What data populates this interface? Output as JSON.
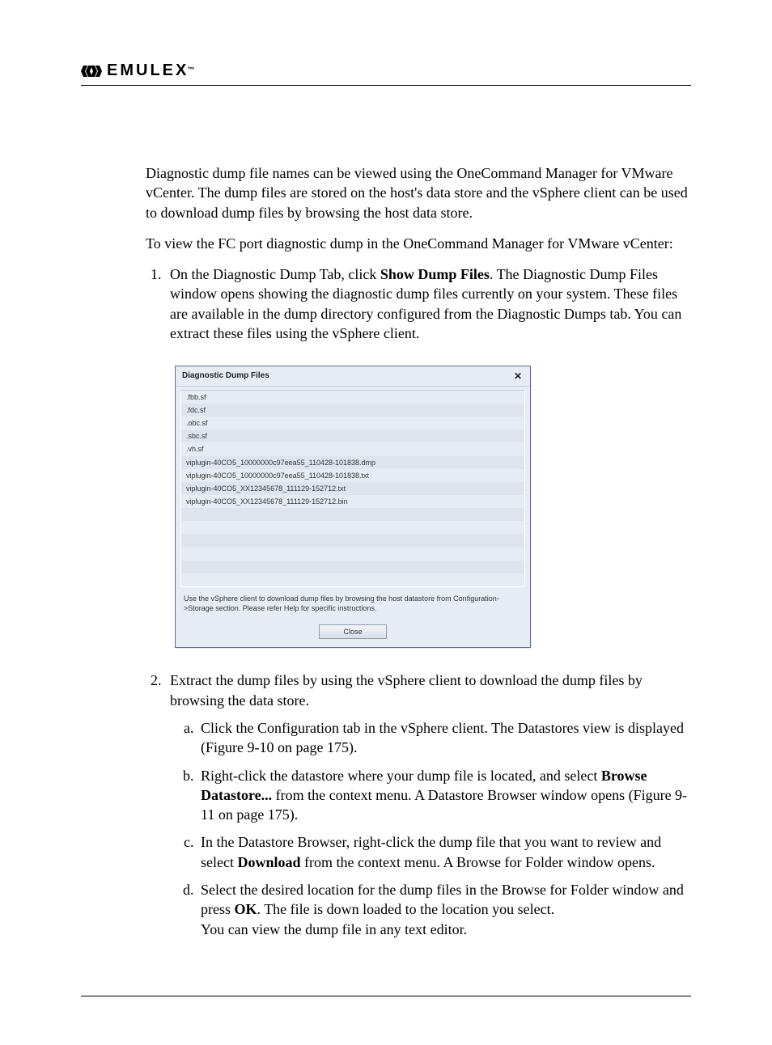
{
  "brand": {
    "name": "EMULEX",
    "trademark": "™"
  },
  "paragraphs": {
    "p1": "Diagnostic dump file names can be viewed using the OneCommand Manager for VMware vCenter. The dump files are stored on the host's data store and the vSphere client can be used to download dump files by browsing the host data store.",
    "p2": "To view the FC port diagnostic dump in the OneCommand Manager for VMware vCenter:"
  },
  "steps": {
    "s1_pre": "On the Diagnostic Dump Tab, click ",
    "s1_bold": "Show Dump Files",
    "s1_post": ". The Diagnostic Dump Files window opens showing the diagnostic dump files currently on your system. These files are available in the dump directory configured from the Diagnostic Dumps tab. You can extract these files using the vSphere client.",
    "s2": "Extract the dump files by using the vSphere client to download the dump files by browsing the data store.",
    "s2a": "Click the Configuration tab in the vSphere client. The Datastores view is displayed (Figure 9-10 on page 175).",
    "s2b_pre": "Right-click the datastore where your dump file is located, and select ",
    "s2b_bold": "Browse Datastore...",
    "s2b_post": " from the context menu. A Datastore Browser window opens (Figure 9-11 on page 175).",
    "s2c_pre": "In the Datastore Browser, right-click the dump file that you want to review and select ",
    "s2c_bold": "Download",
    "s2c_post": " from the context menu. A Browse for Folder window opens.",
    "s2d_pre": "Select the desired location for the dump files in the Browse for Folder window and press ",
    "s2d_bold": "OK",
    "s2d_post": ". The file is down loaded to the location you select.",
    "s2d_follow": "You can view the dump file in any text editor."
  },
  "dialog": {
    "title": "Diagnostic Dump Files",
    "files": [
      ".fbb.sf",
      ".fdc.sf",
      ".obc.sf",
      ".sbc.sf",
      ".vh.sf",
      "viplugin-40CO5_10000000c97eea55_110428-101838.dmp",
      "viplugin-40CO5_10000000c97eea55_110428-101838.txt",
      "viplugin-40CO5_XX12345678_111129-152712.txt",
      "viplugin-40CO5_XX12345678_111129-152712.bin"
    ],
    "blank_rows": 6,
    "hint": "Use the vSphere client to download dump files by browsing the host datastore from Configuration->Storage section. Please refer Help for specific instructions.",
    "close_button": "Close"
  }
}
